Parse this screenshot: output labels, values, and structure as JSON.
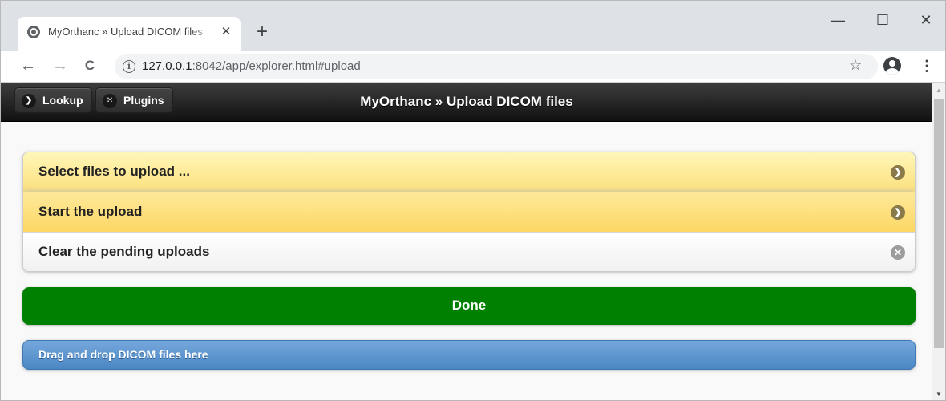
{
  "browser": {
    "tab_title": "MyOrthanc » Upload DICOM files",
    "tab_close": "✕",
    "new_tab": "+",
    "window_controls": {
      "minimize": "—",
      "maximize": "☐",
      "close": "✕"
    },
    "nav": {
      "back": "←",
      "forward": "→",
      "reload": "C"
    },
    "url_host": "127.0.0.1",
    "url_rest": ":8042/app/explorer.html#upload",
    "info_glyph": "i",
    "star_glyph": "☆",
    "menu_glyph": "⋮",
    "icons": [
      "globe-icon",
      "info-icon",
      "star-icon",
      "profile-icon",
      "kebab-menu-icon"
    ]
  },
  "header": {
    "title": "MyOrthanc » Upload DICOM files",
    "buttons": [
      {
        "label": "Lookup",
        "icon": "chevron-right-icon",
        "glyph": "❯"
      },
      {
        "label": "Plugins",
        "icon": "grid-icon",
        "glyph": "⁙"
      }
    ]
  },
  "upload": {
    "items": [
      {
        "label": "Select files to upload ...",
        "icon": "chevron-right-icon",
        "glyph": "❯"
      },
      {
        "label": "Start the upload",
        "icon": "chevron-right-icon",
        "glyph": "❯"
      },
      {
        "label": "Clear the pending uploads",
        "icon": "delete-icon",
        "glyph": "✕"
      }
    ],
    "done_label": "Done",
    "dropzone_label": "Drag and drop DICOM files here"
  },
  "colors": {
    "done_green": "#008000",
    "list_yellow": "#fde07d",
    "dropzone_blue": "#4b87c5",
    "header_dark": "#1c1c1c"
  }
}
